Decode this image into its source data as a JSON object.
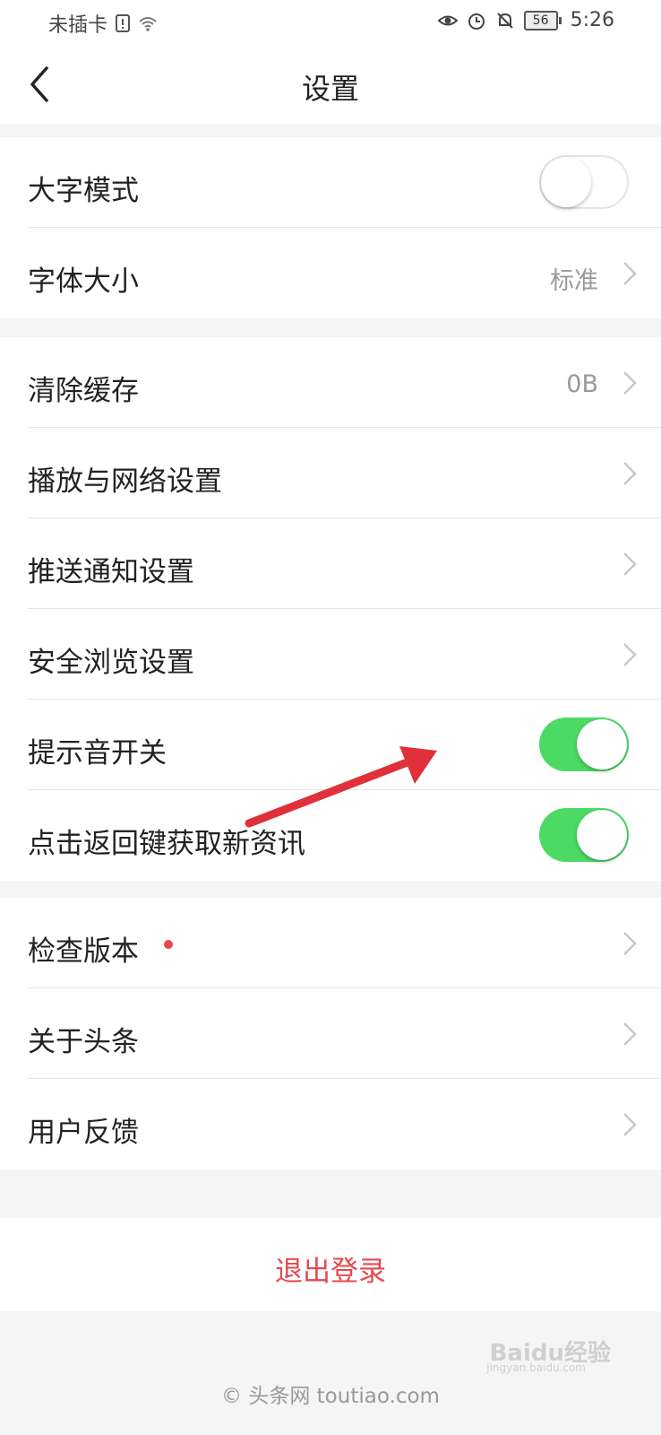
{
  "status_bar": {
    "carrier": "未插卡",
    "time": "5:26",
    "battery": "56"
  },
  "header": {
    "title": "设置",
    "back_icon": "chevron-left-icon"
  },
  "sections": [
    {
      "rows": [
        {
          "label": "大字模式",
          "type": "toggle",
          "on": false
        },
        {
          "label": "字体大小",
          "type": "link",
          "value": "标准"
        }
      ]
    },
    {
      "rows": [
        {
          "label": "清除缓存",
          "type": "link",
          "value": "0B"
        },
        {
          "label": "播放与网络设置",
          "type": "link"
        },
        {
          "label": "推送通知设置",
          "type": "link"
        },
        {
          "label": "安全浏览设置",
          "type": "link"
        },
        {
          "label": "提示音开关",
          "type": "toggle",
          "on": true
        },
        {
          "label": "点击返回键获取新资讯",
          "type": "toggle",
          "on": true
        }
      ]
    },
    {
      "rows": [
        {
          "label": "检查版本",
          "type": "link",
          "badge": "red-dot"
        },
        {
          "label": "关于头条",
          "type": "link"
        },
        {
          "label": "用户反馈",
          "type": "link"
        }
      ]
    }
  ],
  "logout": {
    "label": "退出登录"
  },
  "footer": {
    "copyright": "© 头条网 toutiao.com"
  },
  "watermark": {
    "text": "Baidu经验",
    "sub": "jingyan.baidu.com"
  },
  "colors": {
    "accent_red": "#e5484d",
    "toggle_on": "#4cd964"
  }
}
